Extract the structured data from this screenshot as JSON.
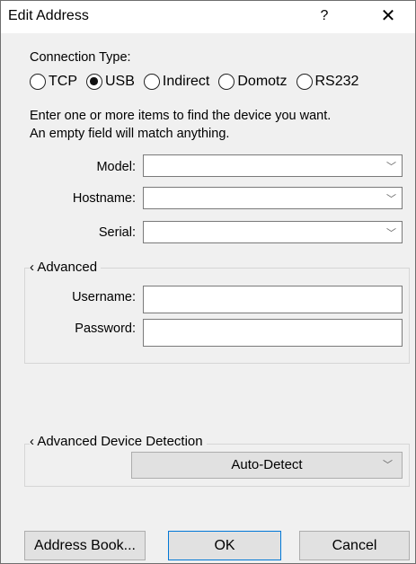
{
  "window": {
    "title": "Edit Address",
    "help_label": "?",
    "close_label": "✕"
  },
  "connection": {
    "label": "Connection Type:",
    "options": [
      {
        "label": "TCP",
        "selected": false
      },
      {
        "label": "USB",
        "selected": true
      },
      {
        "label": "Indirect",
        "selected": false
      },
      {
        "label": "Domotz",
        "selected": false
      },
      {
        "label": "RS232",
        "selected": false
      }
    ]
  },
  "instructions": {
    "line1": "Enter one or more items to find the device you want.",
    "line2": "An empty field will match anything."
  },
  "fields": {
    "model_label": "Model:",
    "model_value": "",
    "hostname_label": "Hostname:",
    "hostname_value": "",
    "serial_label": "Serial:",
    "serial_value": ""
  },
  "advanced": {
    "title": "‹ Advanced",
    "username_label": "Username:",
    "username_value": "",
    "password_label": "Password:",
    "password_value": ""
  },
  "detection": {
    "title": "‹ Advanced Device Detection",
    "value": "Auto-Detect"
  },
  "buttons": {
    "address_book": "Address Book...",
    "ok": "OK",
    "cancel": "Cancel"
  },
  "icons": {
    "chevron": "chevron-down-icon"
  }
}
